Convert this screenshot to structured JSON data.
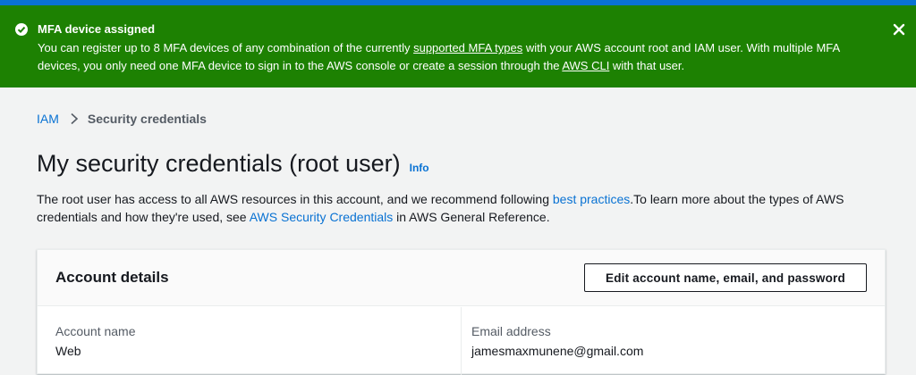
{
  "colors": {
    "success": "#1d8102",
    "link": "#0972d3",
    "top_bar": "#0972d3",
    "background": "#f2f3f3"
  },
  "flash": {
    "icon": "check-circle-icon",
    "title": "MFA device assigned",
    "message_part1": "You can register up to 8 MFA devices of any combination of the currently ",
    "link1": "supported MFA types",
    "message_part2": " with your AWS account root and IAM user. With multiple MFA devices, you only need one MFA device to sign in to the AWS console or create a session through the ",
    "link2": "AWS CLI",
    "message_part3": " with that user.",
    "close_icon": "close-icon"
  },
  "breadcrumb": {
    "items": [
      {
        "label": "IAM"
      },
      {
        "label": "Security credentials"
      }
    ],
    "separator_icon": "chevron-right-icon"
  },
  "page": {
    "title": "My security credentials (root user)",
    "info_label": "Info",
    "description_part1": "The root user has access to all AWS resources in this account, and we recommend following ",
    "best_practices_link": "best practices",
    "description_part2": ".To learn more about the types of AWS credentials and how they're used, see ",
    "security_credentials_link": "AWS Security Credentials",
    "description_part3": " in AWS General Reference."
  },
  "account_details": {
    "title": "Account details",
    "edit_button_label": "Edit account name, email, and password",
    "account_name_label": "Account name",
    "account_name_value": "Web",
    "email_label": "Email address",
    "email_value": "jamesmaxmunene@gmail.com"
  }
}
